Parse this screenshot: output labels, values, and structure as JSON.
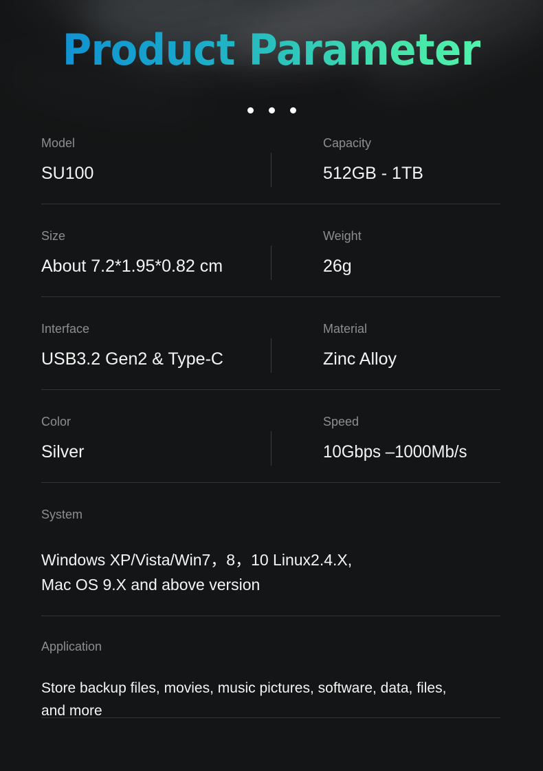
{
  "title": "Product Parameter",
  "separator_dots": 3,
  "colors": {
    "background": "#141516",
    "title_gradient_start": "#1193d2",
    "title_gradient_end": "#50f3ac",
    "label_text": "#8d8e8f",
    "value_text": "#f4f4f4",
    "divider": "#343536"
  },
  "specs": [
    {
      "left": {
        "label": "Model",
        "value": "SU100"
      },
      "right": {
        "label": "Capacity",
        "value": "512GB - 1TB"
      }
    },
    {
      "left": {
        "label": "Size",
        "value": "About 7.2*1.95*0.82 cm"
      },
      "right": {
        "label": "Weight",
        "value": "26g"
      }
    },
    {
      "left": {
        "label": "Interface",
        "value": "USB3.2 Gen2 & Type-C"
      },
      "right": {
        "label": "Material",
        "value": "Zinc Alloy"
      }
    },
    {
      "left": {
        "label": "Color",
        "value": "Silver"
      },
      "right": {
        "label": "Speed",
        "value": "10Gbps –1000Mb/s"
      }
    }
  ],
  "system": {
    "label": "System",
    "line1": "Windows XP/Vista/Win7，8，10 Linux2.4.X,",
    "line2": "Mac OS 9.X and above version"
  },
  "application": {
    "label": "Application",
    "line1": "Store backup files, movies, music pictures, software, data, files,",
    "line2": "and more"
  }
}
